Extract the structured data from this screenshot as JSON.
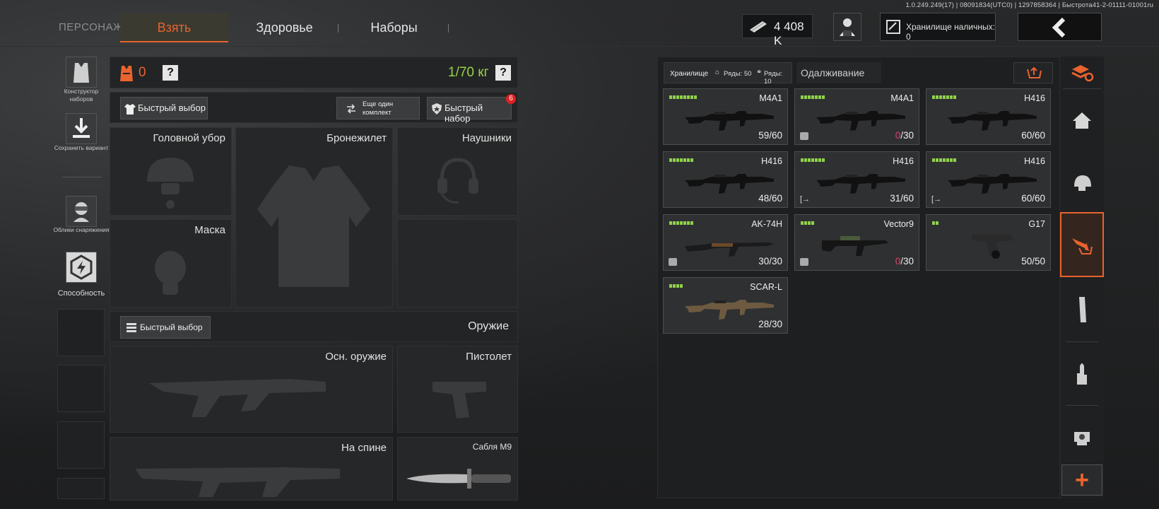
{
  "version_text": "1.0.249.249(17) | 08091834(UTC0) | 1297858364 | Быстрота41-2-01111-01001ru",
  "nav": {
    "title": "ПЕРСОНАЖ",
    "tabs": [
      {
        "label": "Взять",
        "active": true
      },
      {
        "label": "Здоровье",
        "active": false
      },
      {
        "label": "Наборы",
        "active": false
      }
    ]
  },
  "header": {
    "money": "4 408 K",
    "storage_cash_label": "Хранилище наличных: 0",
    "icons": [
      "cash-icon",
      "character-icon",
      "storage-icon",
      "back-arrow-icon"
    ]
  },
  "left_sidebar": {
    "items": [
      {
        "label": "Конструктор наборов",
        "icon": "vest-icon"
      },
      {
        "label": "Сохранить вариант",
        "icon": "download-icon"
      },
      {
        "label": "Облики снаряжения",
        "icon": "skin-icon"
      },
      {
        "label": "Способность",
        "icon": "ability-icon"
      }
    ]
  },
  "loadout": {
    "armor_count": "0",
    "help": "?",
    "weight": "1/70 кг",
    "quick_select": "Быстрый выбор",
    "another_kit": "Еще один комплект",
    "quick_kit": "Быстрый набор",
    "quick_kit_badge": "6",
    "slots": {
      "headgear": "Головной убор",
      "vest": "Бронежилет",
      "headphones": "Наушники",
      "mask": "Маска"
    },
    "weapons_quick_select": "Быстрый выбор",
    "weapons_title": "Оружие",
    "weapon_slots": {
      "primary": "Осн. оружие",
      "pistol": "Пистолет",
      "back": "На спине",
      "melee": "Сабля M9"
    }
  },
  "storage": {
    "label": "Хранилище",
    "rows1": "Ряды: 50",
    "rows2": "Ряды: 10",
    "borrow_tab": "Одалживание",
    "accent": "#e8632e",
    "weapons": [
      {
        "name": "M4A1",
        "ammo_cur": "59",
        "ammo_max": "/60",
        "bars": 8,
        "empty": false,
        "badge": ""
      },
      {
        "name": "M4A1",
        "ammo_cur": "0",
        "ammo_max": "/30",
        "bars": 7,
        "empty": true,
        "badge": "box"
      },
      {
        "name": "H416",
        "ammo_cur": "60",
        "ammo_max": "/60",
        "bars": 7,
        "empty": false,
        "badge": ""
      },
      {
        "name": "H416",
        "ammo_cur": "48",
        "ammo_max": "/60",
        "bars": 7,
        "empty": false,
        "badge": ""
      },
      {
        "name": "H416",
        "ammo_cur": "31",
        "ammo_max": "/60",
        "bars": 7,
        "empty": false,
        "badge": "out"
      },
      {
        "name": "H416",
        "ammo_cur": "60",
        "ammo_max": "/60",
        "bars": 7,
        "empty": false,
        "badge": "out"
      },
      {
        "name": "AK-74H",
        "ammo_cur": "30",
        "ammo_max": "/30",
        "bars": 7,
        "empty": false,
        "badge": "box"
      },
      {
        "name": "Vector9",
        "ammo_cur": "0",
        "ammo_max": "/30",
        "bars": 4,
        "empty": true,
        "badge": "box"
      },
      {
        "name": "G17",
        "ammo_cur": "50",
        "ammo_max": "/50",
        "bars": 2,
        "empty": false,
        "badge": ""
      },
      {
        "name": "SCAR-L",
        "ammo_cur": "28",
        "ammo_max": "/30",
        "bars": 4,
        "empty": false,
        "badge": ""
      }
    ]
  },
  "right_sidebar": {
    "items": [
      "stack-refresh-icon",
      "home-icon",
      "helmet-icon",
      "weapon-storage-icon",
      "magazine-icon",
      "ammo-icon",
      "scope-icon"
    ],
    "active_index": 3,
    "add_label": "+"
  }
}
